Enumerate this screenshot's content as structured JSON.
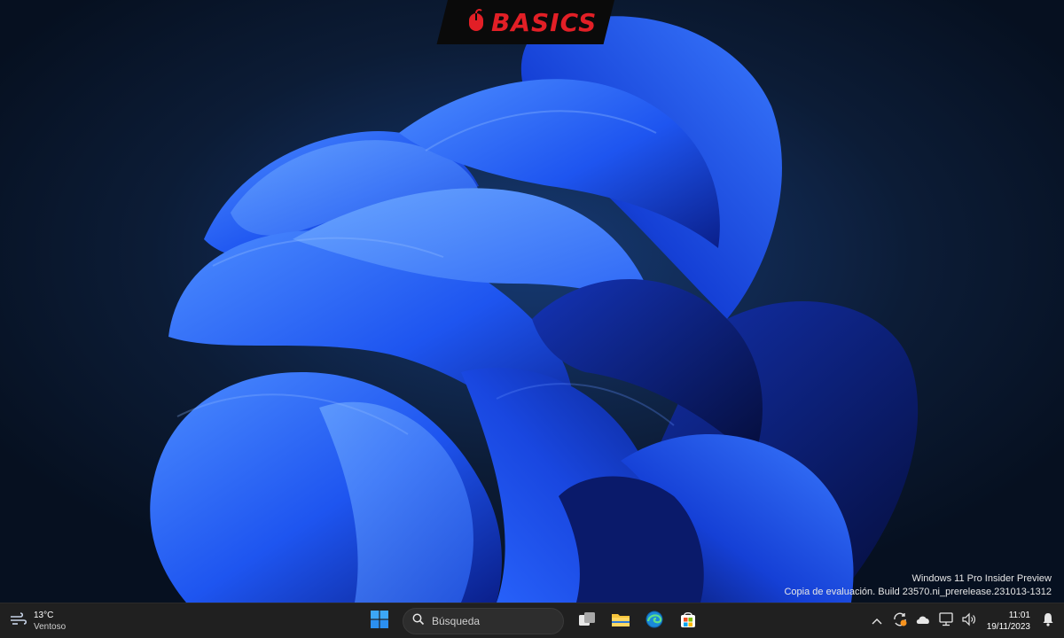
{
  "logo": {
    "text": "BASICS",
    "icon": "mouse-icon",
    "color": "#e21f26"
  },
  "desktop": {
    "watermark_line1": "Windows 11 Pro Insider Preview",
    "watermark_line2": "Copia de evaluación. Build 23570.ni_prerelease.231013-1312"
  },
  "taskbar": {
    "weather": {
      "icon": "wind-icon",
      "temperature": "13°C",
      "condition": "Ventoso"
    },
    "start_icon": "windows-start-icon",
    "search": {
      "label": "Búsqueda",
      "icon": "search-icon"
    },
    "apps": [
      {
        "name": "task-view",
        "icon": "task-view-icon"
      },
      {
        "name": "file-explorer",
        "icon": "folder-icon"
      },
      {
        "name": "edge",
        "icon": "edge-icon"
      },
      {
        "name": "store",
        "icon": "store-icon"
      }
    ],
    "tray": {
      "icons": [
        "chevron-up-icon",
        "sync-icon",
        "cloud-icon",
        "network-icon",
        "volume-icon"
      ],
      "time": "11:01",
      "date": "19/11/2023",
      "notification_icon": "bell-icon"
    }
  },
  "colors": {
    "taskbar_bg": "#202020",
    "accent": "#1f6fff"
  }
}
